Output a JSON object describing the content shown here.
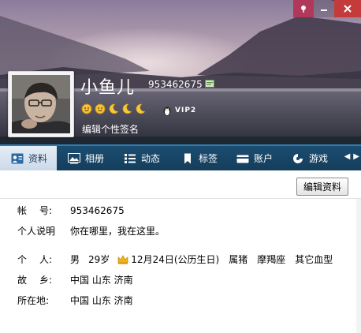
{
  "header": {
    "nickname": "小鱼儿",
    "qq_number": "953462675",
    "vip": "VIP2",
    "signature": "编辑个性签名",
    "status_icons": [
      "smiley-icon",
      "smiley-icon",
      "moon-icon",
      "moon-icon",
      "moon-icon"
    ]
  },
  "window_buttons": [
    "pin-icon",
    "minimize-icon",
    "close-icon"
  ],
  "tabs": [
    {
      "label": "资料",
      "icon": "profile-card-icon",
      "active": true
    },
    {
      "label": "相册",
      "icon": "photo-album-icon",
      "active": false
    },
    {
      "label": "动态",
      "icon": "feed-icon",
      "active": false
    },
    {
      "label": "标签",
      "icon": "bookmark-icon",
      "active": false
    },
    {
      "label": "账户",
      "icon": "account-icon",
      "active": false
    },
    {
      "label": "游戏",
      "icon": "game-icon",
      "active": false
    }
  ],
  "edit_button": "编辑资料",
  "profile": {
    "account": {
      "label_chars": [
        "帐",
        "号:"
      ],
      "value": "953462675"
    },
    "bio": {
      "label": "个人说明",
      "value": "你在哪里，我在这里。"
    },
    "personal": {
      "label_chars": [
        "个",
        "人:"
      ],
      "gender": "男",
      "age": "29岁",
      "birthday": "12月24日(公历生日)",
      "zodiac": "属猪",
      "constellation": "摩羯座",
      "blood": "其它血型"
    },
    "hometown": {
      "label_chars": [
        "故",
        "乡:"
      ],
      "value": "中国 山东 济南"
    },
    "location": {
      "label": "所在地:",
      "value": "中国 山东 济南"
    }
  },
  "colors": {
    "accent": "#2f7db3",
    "tabbar": "#1b4d70",
    "close": "#c43b3b"
  }
}
